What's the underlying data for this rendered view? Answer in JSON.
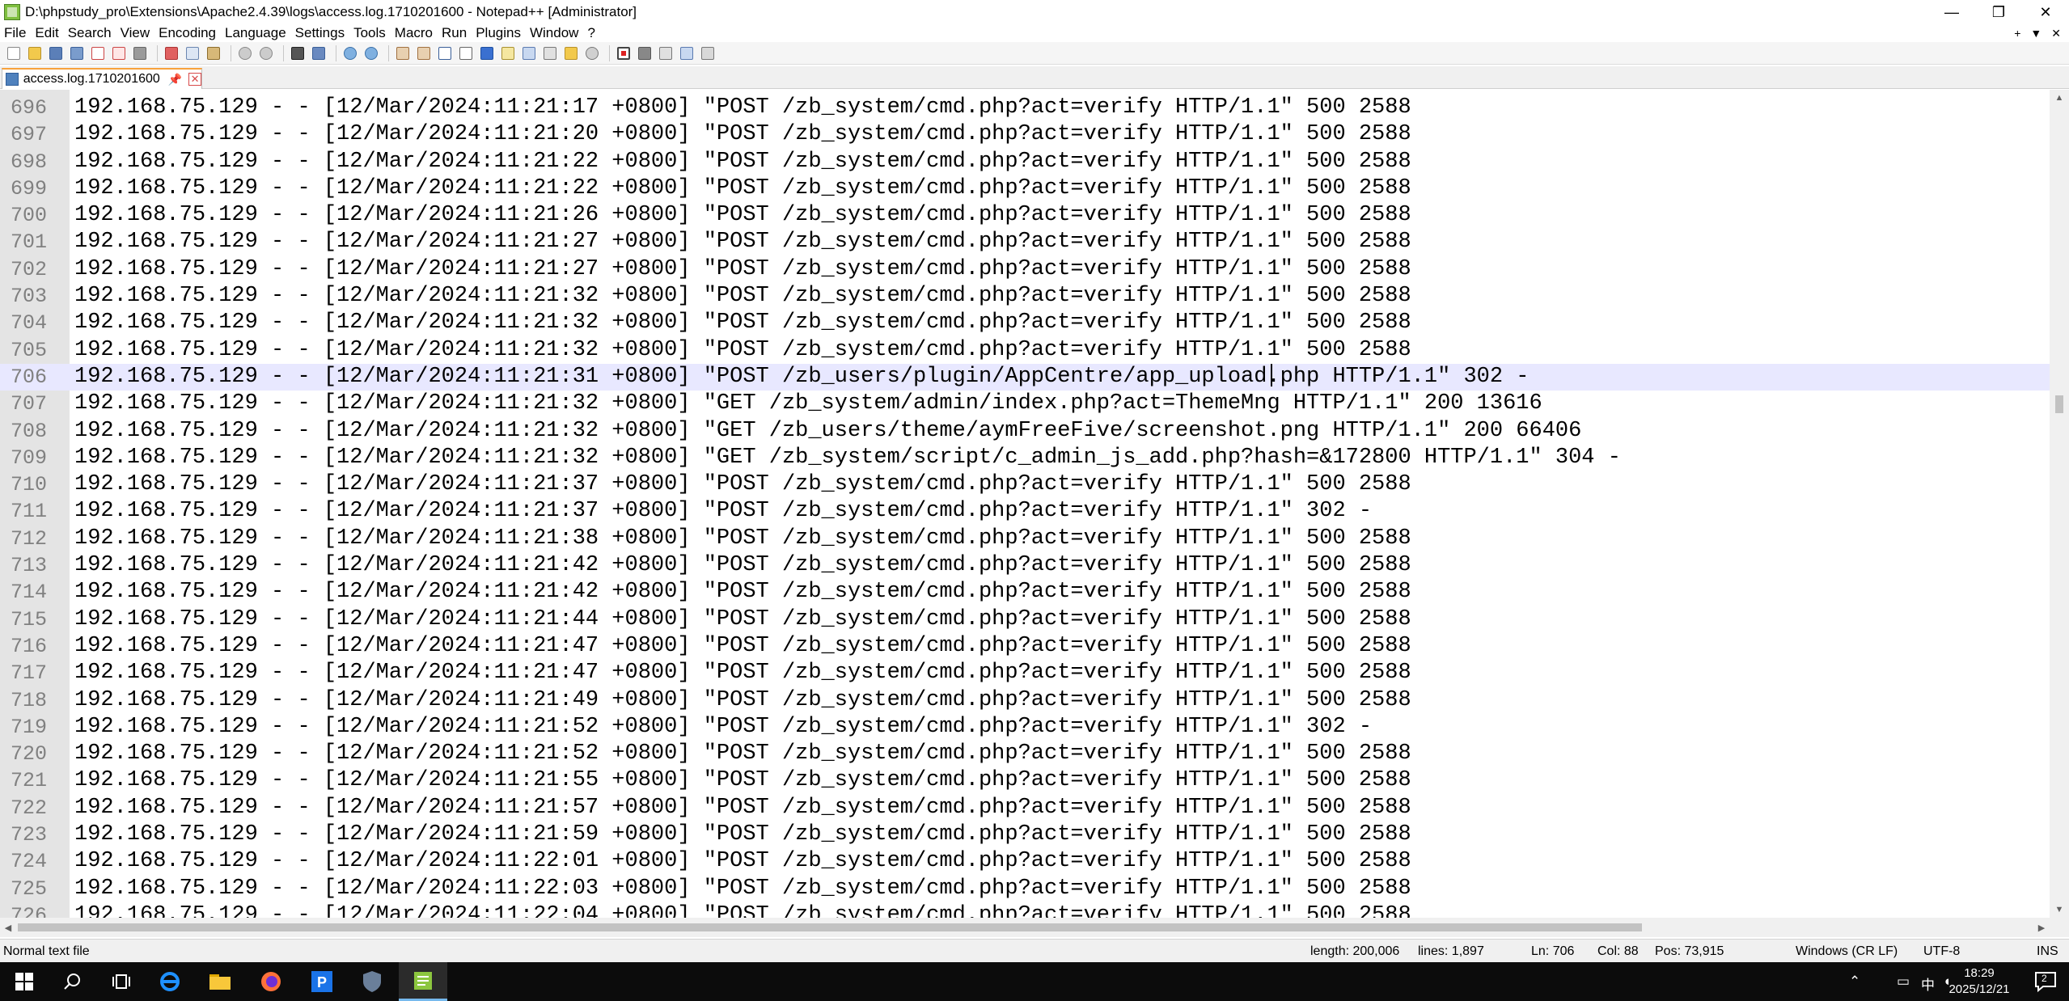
{
  "window": {
    "title": "D:\\phpstudy_pro\\Extensions\\Apache2.4.39\\logs\\access.log.1710201600 - Notepad++ [Administrator]",
    "controls": {
      "minimize": "—",
      "maximize": "❐",
      "close": "✕"
    }
  },
  "menu": {
    "items": [
      "File",
      "Edit",
      "Search",
      "View",
      "Encoding",
      "Language",
      "Settings",
      "Tools",
      "Macro",
      "Run",
      "Plugins",
      "Window",
      "?"
    ],
    "right": {
      "plus": "+",
      "dropdown": "▼",
      "close": "✕"
    }
  },
  "tab": {
    "label": "access.log.1710201600",
    "pin": "📌",
    "close": "✕"
  },
  "editor": {
    "lines": [
      {
        "n": "696",
        "text": "192.168.75.129 - - [12/Mar/2024:11:21:17 +0800] \"POST /zb_system/cmd.php?act=verify HTTP/1.1\" 500 2588"
      },
      {
        "n": "697",
        "text": "192.168.75.129 - - [12/Mar/2024:11:21:20 +0800] \"POST /zb_system/cmd.php?act=verify HTTP/1.1\" 500 2588"
      },
      {
        "n": "698",
        "text": "192.168.75.129 - - [12/Mar/2024:11:21:22 +0800] \"POST /zb_system/cmd.php?act=verify HTTP/1.1\" 500 2588"
      },
      {
        "n": "699",
        "text": "192.168.75.129 - - [12/Mar/2024:11:21:22 +0800] \"POST /zb_system/cmd.php?act=verify HTTP/1.1\" 500 2588"
      },
      {
        "n": "700",
        "text": "192.168.75.129 - - [12/Mar/2024:11:21:26 +0800] \"POST /zb_system/cmd.php?act=verify HTTP/1.1\" 500 2588"
      },
      {
        "n": "701",
        "text": "192.168.75.129 - - [12/Mar/2024:11:21:27 +0800] \"POST /zb_system/cmd.php?act=verify HTTP/1.1\" 500 2588"
      },
      {
        "n": "702",
        "text": "192.168.75.129 - - [12/Mar/2024:11:21:27 +0800] \"POST /zb_system/cmd.php?act=verify HTTP/1.1\" 500 2588"
      },
      {
        "n": "703",
        "text": "192.168.75.129 - - [12/Mar/2024:11:21:32 +0800] \"POST /zb_system/cmd.php?act=verify HTTP/1.1\" 500 2588"
      },
      {
        "n": "704",
        "text": "192.168.75.129 - - [12/Mar/2024:11:21:32 +0800] \"POST /zb_system/cmd.php?act=verify HTTP/1.1\" 500 2588"
      },
      {
        "n": "705",
        "text": "192.168.75.129 - - [12/Mar/2024:11:21:32 +0800] \"POST /zb_system/cmd.php?act=verify HTTP/1.1\" 500 2588"
      },
      {
        "n": "706",
        "text": "192.168.75.129 - - [12/Mar/2024:11:21:31 +0800] \"POST /zb_users/plugin/AppCentre/app_upload.php HTTP/1.1\" 302 -",
        "current": true
      },
      {
        "n": "707",
        "text": "192.168.75.129 - - [12/Mar/2024:11:21:32 +0800] \"GET /zb_system/admin/index.php?act=ThemeMng HTTP/1.1\" 200 13616"
      },
      {
        "n": "708",
        "text": "192.168.75.129 - - [12/Mar/2024:11:21:32 +0800] \"GET /zb_users/theme/aymFreeFive/screenshot.png HTTP/1.1\" 200 66406"
      },
      {
        "n": "709",
        "text": "192.168.75.129 - - [12/Mar/2024:11:21:32 +0800] \"GET /zb_system/script/c_admin_js_add.php?hash=&172800 HTTP/1.1\" 304 -"
      },
      {
        "n": "710",
        "text": "192.168.75.129 - - [12/Mar/2024:11:21:37 +0800] \"POST /zb_system/cmd.php?act=verify HTTP/1.1\" 500 2588"
      },
      {
        "n": "711",
        "text": "192.168.75.129 - - [12/Mar/2024:11:21:37 +0800] \"POST /zb_system/cmd.php?act=verify HTTP/1.1\" 302 -"
      },
      {
        "n": "712",
        "text": "192.168.75.129 - - [12/Mar/2024:11:21:38 +0800] \"POST /zb_system/cmd.php?act=verify HTTP/1.1\" 500 2588"
      },
      {
        "n": "713",
        "text": "192.168.75.129 - - [12/Mar/2024:11:21:42 +0800] \"POST /zb_system/cmd.php?act=verify HTTP/1.1\" 500 2588"
      },
      {
        "n": "714",
        "text": "192.168.75.129 - - [12/Mar/2024:11:21:42 +0800] \"POST /zb_system/cmd.php?act=verify HTTP/1.1\" 500 2588"
      },
      {
        "n": "715",
        "text": "192.168.75.129 - - [12/Mar/2024:11:21:44 +0800] \"POST /zb_system/cmd.php?act=verify HTTP/1.1\" 500 2588"
      },
      {
        "n": "716",
        "text": "192.168.75.129 - - [12/Mar/2024:11:21:47 +0800] \"POST /zb_system/cmd.php?act=verify HTTP/1.1\" 500 2588"
      },
      {
        "n": "717",
        "text": "192.168.75.129 - - [12/Mar/2024:11:21:47 +0800] \"POST /zb_system/cmd.php?act=verify HTTP/1.1\" 500 2588"
      },
      {
        "n": "718",
        "text": "192.168.75.129 - - [12/Mar/2024:11:21:49 +0800] \"POST /zb_system/cmd.php?act=verify HTTP/1.1\" 500 2588"
      },
      {
        "n": "719",
        "text": "192.168.75.129 - - [12/Mar/2024:11:21:52 +0800] \"POST /zb_system/cmd.php?act=verify HTTP/1.1\" 302 -"
      },
      {
        "n": "720",
        "text": "192.168.75.129 - - [12/Mar/2024:11:21:52 +0800] \"POST /zb_system/cmd.php?act=verify HTTP/1.1\" 500 2588"
      },
      {
        "n": "721",
        "text": "192.168.75.129 - - [12/Mar/2024:11:21:55 +0800] \"POST /zb_system/cmd.php?act=verify HTTP/1.1\" 500 2588"
      },
      {
        "n": "722",
        "text": "192.168.75.129 - - [12/Mar/2024:11:21:57 +0800] \"POST /zb_system/cmd.php?act=verify HTTP/1.1\" 500 2588"
      },
      {
        "n": "723",
        "text": "192.168.75.129 - - [12/Mar/2024:11:21:59 +0800] \"POST /zb_system/cmd.php?act=verify HTTP/1.1\" 500 2588"
      },
      {
        "n": "724",
        "text": "192.168.75.129 - - [12/Mar/2024:11:22:01 +0800] \"POST /zb_system/cmd.php?act=verify HTTP/1.1\" 500 2588"
      },
      {
        "n": "725",
        "text": "192.168.75.129 - - [12/Mar/2024:11:22:03 +0800] \"POST /zb_system/cmd.php?act=verify HTTP/1.1\" 500 2588"
      },
      {
        "n": "726",
        "text": "192.168.75.129 - - [12/Mar/2024:11:22:04 +0800] \"POST /zb_system/cmd.php?act=verify HTTP/1.1\" 500 2588"
      }
    ]
  },
  "statusbar": {
    "file_type": "Normal text file",
    "length": "length: 200,006",
    "lines": "lines: 1,897",
    "ln": "Ln: 706",
    "col": "Col: 88",
    "pos": "Pos: 73,915",
    "eol": "Windows (CR LF)",
    "encoding": "UTF-8",
    "mode": "INS"
  },
  "taskbar": {
    "time": "18:29",
    "date": "2025/12/21",
    "ime": "中",
    "notification_count": "2"
  },
  "colors": {
    "current_line": "#e8e8ff",
    "gutter": "#e4e4e4",
    "tab_accent": "#f8a23c",
    "taskbar": "#0c0c0c"
  }
}
